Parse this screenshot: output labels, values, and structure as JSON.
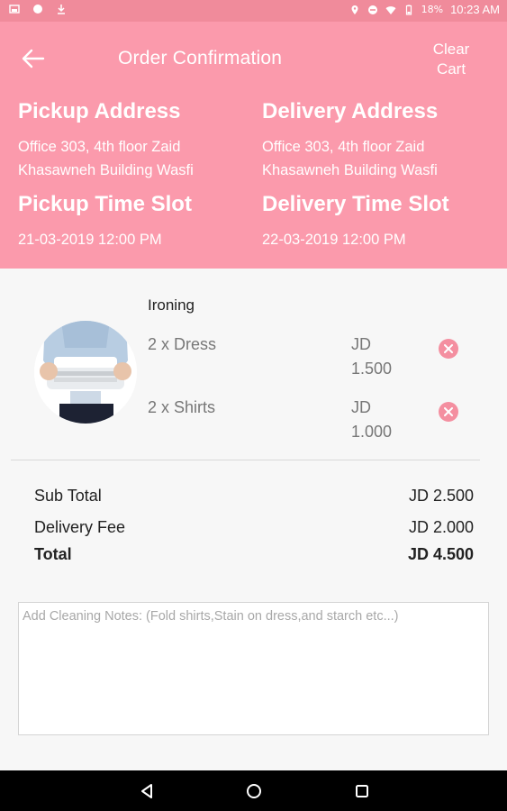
{
  "status_bar": {
    "battery": "18%",
    "time": "10:23 AM"
  },
  "header": {
    "title": "Order Confirmation",
    "clear_cart_line1": "Clear",
    "clear_cart_line2": "Cart",
    "pickup": {
      "label": "Pickup Address",
      "address_line1": "Office 303, 4th floor Zaid",
      "address_line2": "Khasawneh Building Wasfi",
      "slot_label": "Pickup Time Slot",
      "slot_value": "21-03-2019 12:00 PM"
    },
    "delivery": {
      "label": "Delivery Address",
      "address_line1": "Office 303, 4th floor Zaid",
      "address_line2": "Khasawneh Building Wasfi",
      "slot_label": "Delivery Time Slot",
      "slot_value": "22-03-2019 12:00 PM"
    }
  },
  "order": {
    "category": "Ironing",
    "items": [
      {
        "name": "2 x Dress",
        "currency": "JD",
        "price": "1.500"
      },
      {
        "name": "2 x Shirts",
        "currency": "JD",
        "price": "1.000"
      }
    ]
  },
  "summary": {
    "subtotal_label": "Sub Total",
    "subtotal_value": "JD 2.500",
    "delivery_label": "Delivery Fee",
    "delivery_value": "JD 2.000",
    "total_label": "Total",
    "total_value": "JD 4.500"
  },
  "notes": {
    "placeholder": "Add Cleaning Notes: (Fold shirts,Stain on dress,and starch etc...)"
  },
  "colors": {
    "header_bg": "#fb9aac",
    "status_bg": "#f08b9b",
    "remove_icon": "#f48fa0"
  }
}
